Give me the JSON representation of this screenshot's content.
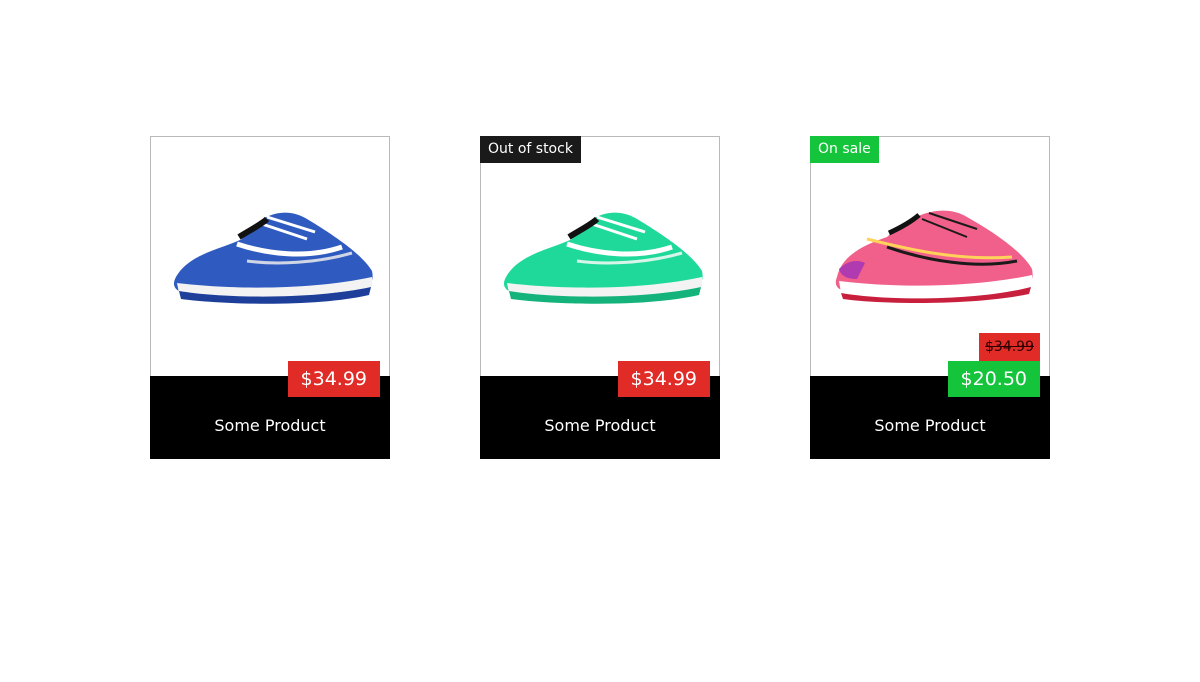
{
  "colors": {
    "price_bg": "#e02b27",
    "sale_bg": "#14c43a",
    "out_of_stock_bg": "#1a1a1a",
    "footer_bg": "#000000"
  },
  "products": [
    {
      "name": "Some Product",
      "price": "$34.99",
      "badge": "",
      "shoe_color": "#2f5bc0"
    },
    {
      "name": "Some Product",
      "price": "$34.99",
      "badge": "Out of stock",
      "shoe_color": "#1fd99a"
    },
    {
      "name": "Some Product",
      "price": "$20.50",
      "old_price": "$34.99",
      "badge": "On sale",
      "shoe_color": "#f0608a"
    }
  ]
}
